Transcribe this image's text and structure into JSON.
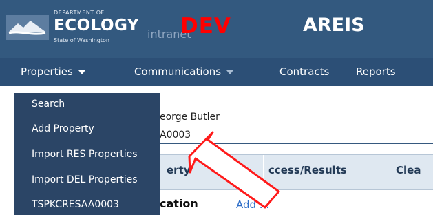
{
  "header": {
    "logo_line1": "DEPARTMENT OF",
    "logo_line2": "ECOLOGY",
    "logo_line3": "intranet",
    "logo_line4": "State of Washington",
    "environment": "DEV",
    "app_title": "AREIS"
  },
  "nav": {
    "items": [
      {
        "label": "Properties"
      },
      {
        "label": "Communications"
      },
      {
        "label": "Contracts"
      },
      {
        "label": "Reports"
      }
    ]
  },
  "dropdown": {
    "items": [
      {
        "label": "Search"
      },
      {
        "label": "Add Property"
      },
      {
        "label": "Import RES Properties"
      },
      {
        "label": "Import DEL Properties"
      },
      {
        "label": "TSPKCRESAA0003"
      }
    ]
  },
  "property": {
    "name_partial": "eorge Butler",
    "id_partial": "A0003"
  },
  "tabs": [
    {
      "label": "erty"
    },
    {
      "label": "ccess/Results"
    },
    {
      "label": "Clea"
    }
  ],
  "section": {
    "label_partial": "cation",
    "add_link": "Add ..."
  },
  "colors": {
    "header_bg": "#33597f",
    "nav_bg": "#2c4f76",
    "dropdown_bg": "#2b4566",
    "env_red": "#ff0000",
    "tab_bg": "#dfe8f1",
    "link_blue": "#2b6cc7",
    "arrow_red": "#ff0000"
  }
}
